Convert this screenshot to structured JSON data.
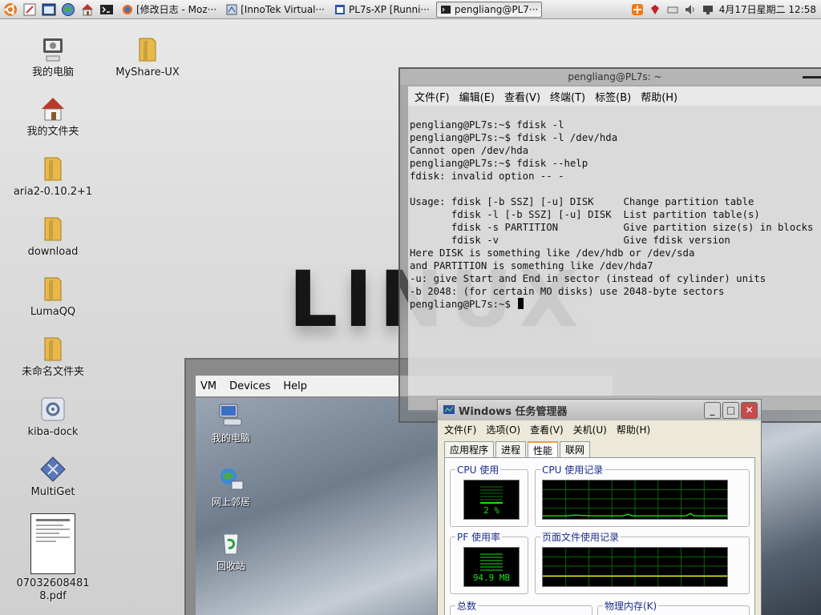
{
  "top_panel": {
    "launchers": [
      "ubuntu-logo-icon",
      "text-editor-icon",
      "terminal-window-icon",
      "browser-globe-icon",
      "home-icon",
      "shell-prompt-icon"
    ],
    "tasks": [
      {
        "label": "[修改日志 - Moz···",
        "active": false
      },
      {
        "label": "[InnoTek Virtual···",
        "active": false
      },
      {
        "label": "PL7s-XP [Runni···",
        "active": false
      },
      {
        "label": "pengliang@PL7···",
        "active": true
      }
    ],
    "clock": "4月17日星期二 12:58"
  },
  "desktop": {
    "watermark": "LINUX",
    "icons": [
      {
        "label": "我的电脑",
        "icon": "computer-icon"
      },
      {
        "label": "MyShare-UX",
        "icon": "folder-icon"
      },
      {
        "label": "我的文件夹",
        "icon": "home-folder-icon"
      },
      {
        "label": "aria2-0.10.2+1",
        "icon": "folder-icon"
      },
      {
        "label": "download",
        "icon": "folder-icon"
      },
      {
        "label": "LumaQQ",
        "icon": "folder-icon"
      },
      {
        "label": "未命名文件夹",
        "icon": "folder-icon"
      },
      {
        "label": "kiba-dock",
        "icon": "settings-gear-icon"
      },
      {
        "label": "MultiGet",
        "icon": "download-diamond-icon"
      },
      {
        "label": "070326084818.pdf",
        "icon": "pdf-document-icon"
      }
    ]
  },
  "terminal": {
    "title": "pengliang@PL7s: ~",
    "menu": [
      "文件(F)",
      "编辑(E)",
      "查看(V)",
      "终端(T)",
      "标签(B)",
      "帮助(H)"
    ],
    "lines": [
      "pengliang@PL7s:~$ fdisk -l",
      "pengliang@PL7s:~$ fdisk -l /dev/hda",
      "Cannot open /dev/hda",
      "pengliang@PL7s:~$ fdisk --help",
      "fdisk: invalid option -- -",
      "",
      "Usage: fdisk [-b SSZ] [-u] DISK     Change partition table",
      "       fdisk -l [-b SSZ] [-u] DISK  List partition table(s)",
      "       fdisk -s PARTITION           Give partition size(s) in blocks",
      "       fdisk -v                     Give fdisk version",
      "Here DISK is something like /dev/hdb or /dev/sda",
      "and PARTITION is something like /dev/hda7",
      "-u: give Start and End in sector (instead of cylinder) units",
      "-b 2048: (for certain MO disks) use 2048-byte sectors"
    ],
    "prompt": "pengliang@PL7s:~$ "
  },
  "vbox": {
    "menu": [
      "VM",
      "Devices",
      "Help"
    ],
    "guest_icons": [
      {
        "label": "我的电脑",
        "icon": "xp-computer-icon"
      },
      {
        "label": "网上邻居",
        "icon": "xp-network-icon"
      },
      {
        "label": "回收站",
        "icon": "xp-recycle-bin-icon"
      }
    ]
  },
  "taskmgr": {
    "title": "Windows 任务管理器",
    "menu": [
      "文件(F)",
      "选项(O)",
      "查看(V)",
      "关机(U)",
      "帮助(H)"
    ],
    "tabs": [
      "应用程序",
      "进程",
      "性能",
      "联网"
    ],
    "active_tab": "性能",
    "cpu_usage_label": "CPU 使用",
    "cpu_usage_value": "2 %",
    "cpu_history_label": "CPU 使用记录",
    "pf_usage_label": "PF 使用率",
    "pf_usage_value": "94.9 MB",
    "pf_history_label": "页面文件使用记录",
    "totals_label": "总数",
    "physical_memory_label": "物理内存(K)"
  },
  "colors": {
    "meter_green": "#18e018",
    "grid_green": "#0a7a0a",
    "active_tab_accent": "#e7a23d"
  }
}
